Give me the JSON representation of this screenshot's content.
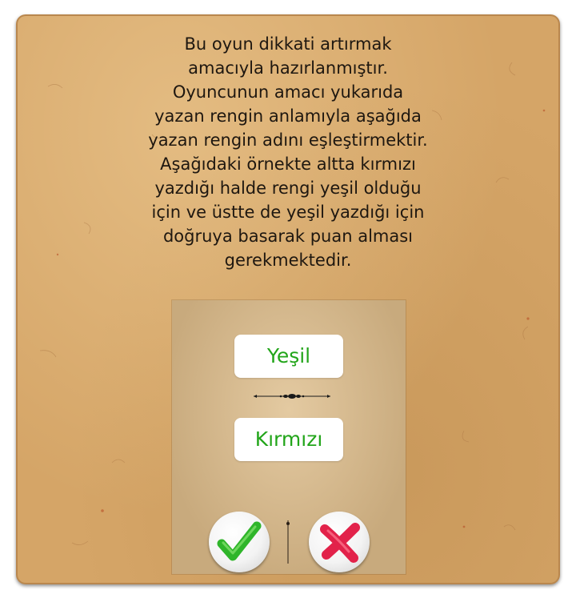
{
  "intro": {
    "lines": [
      "Bu oyun dikkati artırmak",
      "amacıyla hazırlanmıştır.",
      "Oyuncunun amacı yukarıda",
      "yazan rengin anlamıyla aşağıda",
      "yazan rengin adını eşleştirmektir.",
      "Aşağıdaki örnekte altta kırmızı",
      "yazdığı halde rengi yeşil olduğu",
      "için ve üstte de yeşil yazdığı için",
      "doğruya basarak puan alması",
      "gerekmektedir."
    ]
  },
  "example": {
    "top_word": "Yeşil",
    "bottom_word": "Kırmızı",
    "word_color": "#22a51a"
  },
  "buttons": {
    "correct_icon": "checkmark-icon",
    "correct_color": "#2fb52a",
    "wrong_icon": "cross-icon",
    "wrong_color": "#e2224a"
  },
  "colors": {
    "paper": "#d5a567",
    "card": "#ffffff",
    "text": "#1e1710"
  }
}
